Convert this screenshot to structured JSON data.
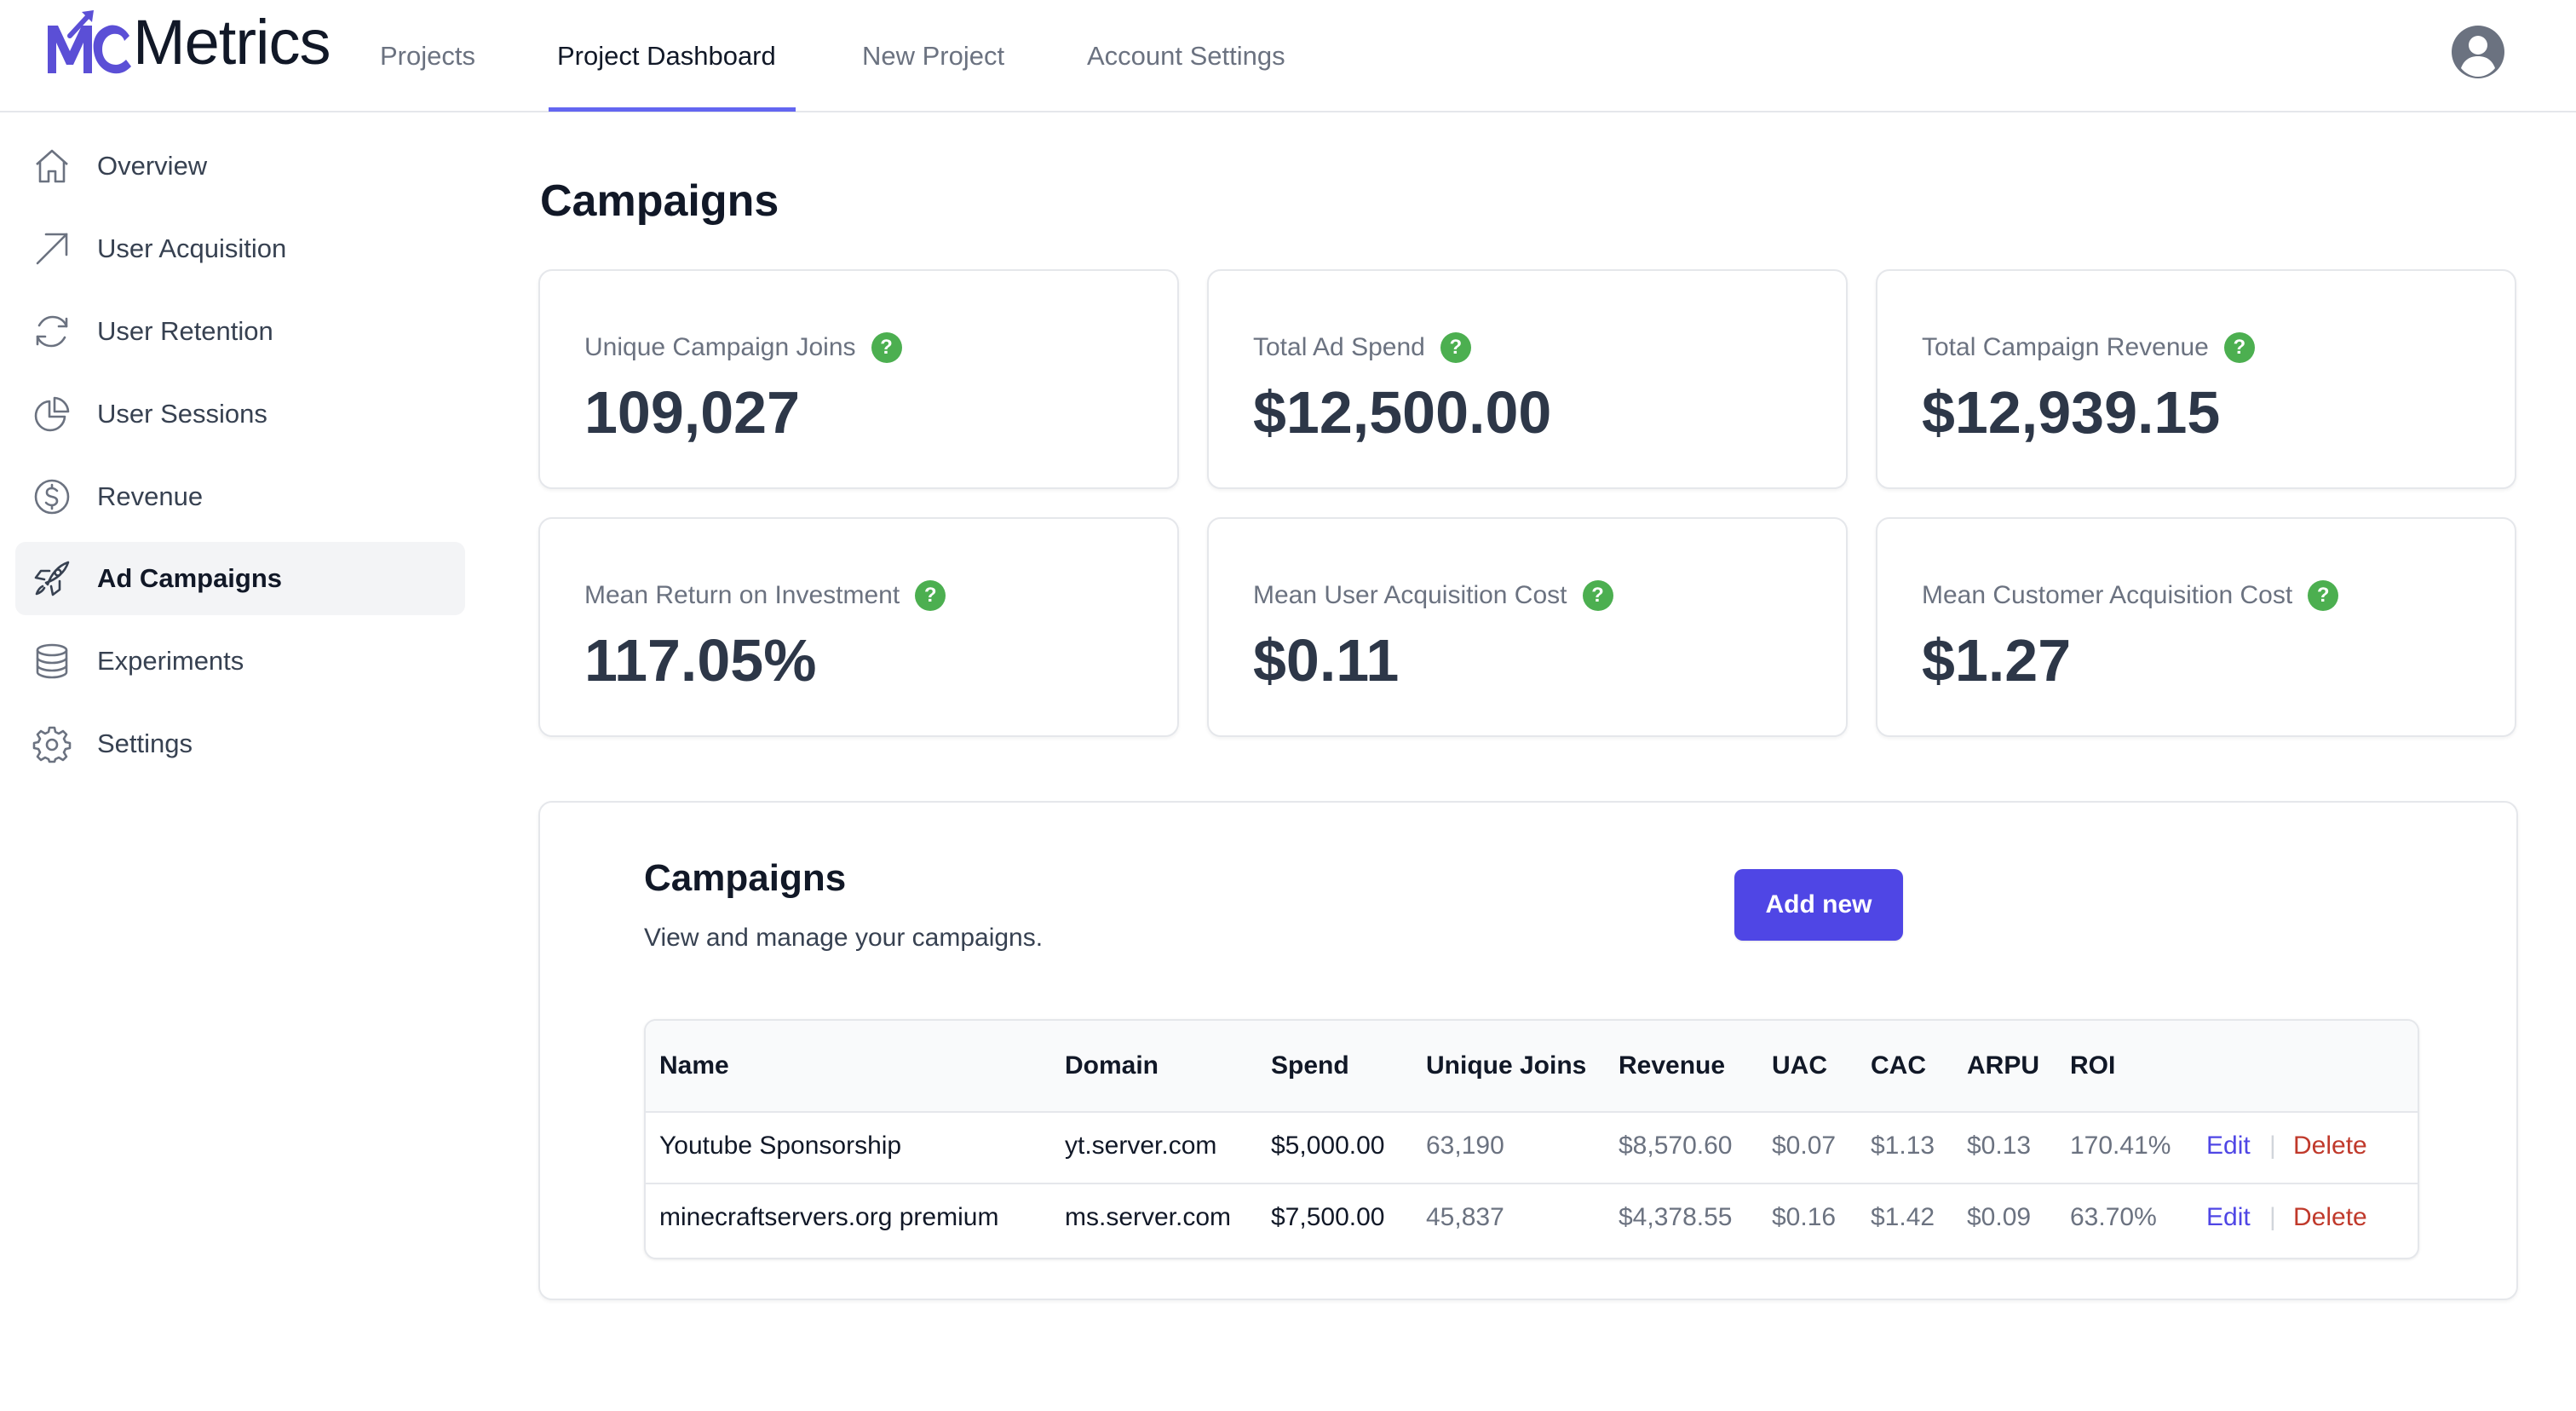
{
  "app": {
    "logo_text": "Metrics",
    "logo_letters": "MC"
  },
  "topnav": {
    "tabs": [
      {
        "label": "Projects"
      },
      {
        "label": "Project Dashboard"
      },
      {
        "label": "New Project"
      },
      {
        "label": "Account Settings"
      }
    ],
    "active_tab": "Project Dashboard"
  },
  "sidebar": {
    "items": [
      {
        "label": "Overview",
        "icon": "home-icon"
      },
      {
        "label": "User Acquisition",
        "icon": "arrow-up-right-icon"
      },
      {
        "label": "User Retention",
        "icon": "refresh-icon"
      },
      {
        "label": "User Sessions",
        "icon": "pie-chart-icon"
      },
      {
        "label": "Revenue",
        "icon": "dollar-icon"
      },
      {
        "label": "Ad Campaigns",
        "icon": "rocket-icon"
      },
      {
        "label": "Experiments",
        "icon": "database-icon"
      },
      {
        "label": "Settings",
        "icon": "gear-icon"
      }
    ],
    "active_item": "Ad Campaigns"
  },
  "main": {
    "title": "Campaigns",
    "stats": [
      {
        "label": "Unique Campaign Joins",
        "value": "109,027"
      },
      {
        "label": "Total Ad Spend",
        "value": "$12,500.00"
      },
      {
        "label": "Total Campaign Revenue",
        "value": "$12,939.15"
      },
      {
        "label": "Mean Return on Investment",
        "value": "117.05%"
      },
      {
        "label": "Mean User Acquisition Cost",
        "value": "$0.11"
      },
      {
        "label": "Mean Customer Acquisition Cost",
        "value": "$1.27"
      }
    ],
    "help_glyph": "?",
    "campaigns_panel": {
      "title": "Campaigns",
      "subtitle": "View and manage your campaigns.",
      "add_button_label": "Add new",
      "table": {
        "headers": [
          "Name",
          "Domain",
          "Spend",
          "Unique Joins",
          "Revenue",
          "UAC",
          "CAC",
          "ARPU",
          "ROI"
        ],
        "rows": [
          {
            "name": "Youtube Sponsorship",
            "domain": "yt.server.com",
            "spend": "$5,000.00",
            "unique_joins": "63,190",
            "revenue": "$8,570.60",
            "uac": "$0.07",
            "cac": "$1.13",
            "arpu": "$0.13",
            "roi": "170.41%"
          },
          {
            "name": "minecraftservers.org premium",
            "domain": "ms.server.com",
            "spend": "$7,500.00",
            "unique_joins": "45,837",
            "revenue": "$4,378.55",
            "uac": "$0.16",
            "cac": "$1.42",
            "arpu": "$0.09",
            "roi": "63.70%"
          }
        ],
        "edit_label": "Edit",
        "separator": "|",
        "delete_label": "Delete"
      }
    }
  },
  "colors": {
    "accent": "#4f46e5",
    "nav_underline": "#6366f1",
    "help_badge": "#4caf50",
    "delete": "#c0392b",
    "logo": "#5b4fd6"
  }
}
